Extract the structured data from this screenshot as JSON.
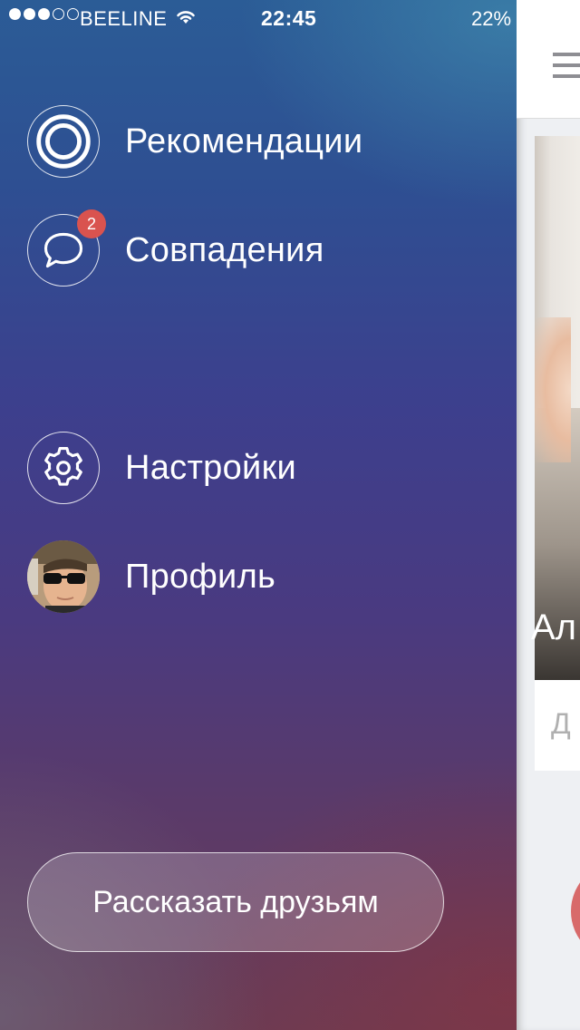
{
  "status_bar": {
    "carrier": "BEELINE",
    "time": "22:45",
    "battery": "22%",
    "signal_bars_filled": 3,
    "signal_bars_total": 5
  },
  "menu": {
    "items": [
      {
        "label": "Рекомендации",
        "icon": "target-icon"
      },
      {
        "label": "Совпадения",
        "icon": "chat-bubble-icon",
        "badge": "2"
      },
      {
        "label": "Настройки",
        "icon": "gear-icon"
      },
      {
        "label": "Профиль",
        "icon": "avatar"
      }
    ]
  },
  "share_button": {
    "label": "Рассказать друзьям"
  },
  "main_peek": {
    "name_fragment": "Ал",
    "sub_fragment": "Д"
  },
  "colors": {
    "badge": "#d9534f",
    "gradient_top": "#2b5c96",
    "gradient_bottom": "#6a3c55"
  }
}
